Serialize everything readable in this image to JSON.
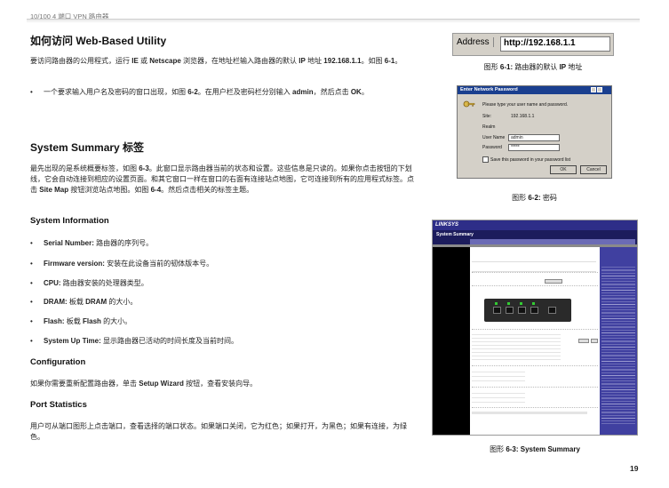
{
  "header": {
    "running_title": "10/100 4 端口 VPN 路由器",
    "page_number": "19"
  },
  "section1": {
    "title": "如何访问 Web-Based Utility",
    "intro_parts": [
      "要访问路由器的公用程式，运行 ",
      "IE",
      " 或 ",
      "Netscape",
      " 浏览器，在地址栏输入路由器的默认 ",
      "IP",
      " 地址 ",
      "192.168.1.1",
      "。如图 ",
      "6-1",
      "。"
    ],
    "bullet_parts": [
      "一个要求输入用户名及密码的窗口出现，如图 ",
      "6-2",
      "。在用户栏及密码栏分别输入 ",
      "admin",
      "，然后点击 ",
      "OK",
      "。"
    ]
  },
  "section2": {
    "title": "System Summary 标签",
    "intro_parts": [
      "最先出现的是系统概要标签，如图 ",
      "6-3",
      "。此窗口显示路由器当前的状态和设置。这些信息是只读的。如果你点击按钮的下划线，它会自动连接到相应的设置页面。和其它窗口一样在窗口的右面有连接站点地图，它可连接到所有的应用程式标签。点击 ",
      "Site Map",
      " 按钮浏览站点地图。如图 ",
      "6-4",
      "。然后点击相关的标签主题。"
    ]
  },
  "system_information": {
    "title": "System Information",
    "items": [
      {
        "term": "Serial Number:",
        "desc": " 路由器的序列号。"
      },
      {
        "term": "Firmware version:",
        "desc": " 安装在此设备当前的韧体版本号。"
      },
      {
        "term": "CPU:",
        "desc": " 路由器安装的处理器类型。"
      },
      {
        "term": "DRAM:",
        "desc_parts": [
          " 板载 ",
          "DRAM",
          " 的大小。"
        ]
      },
      {
        "term": "Flash:",
        "desc_parts": [
          " 板载 ",
          "Flash",
          " 的大小。"
        ]
      },
      {
        "term": "System Up Time:",
        "desc": " 显示路由器已活动的时间长度及当前时间。"
      }
    ]
  },
  "configuration": {
    "title": "Configuration",
    "text_parts": [
      "如果你需要重新配置路由器，单击 ",
      "Setup Wizard",
      " 按钮，查看安装向导。"
    ]
  },
  "port_statistics": {
    "title": "Port Statistics",
    "text": "用户可从端口图形上点击端口，查看选择的端口状态。如果端口关闭，它为红色；如果打开，为黑色；如果有连接，为绿色。"
  },
  "figures": {
    "fig1": {
      "address_label": "Address",
      "url": "http://192.168.1.1",
      "caption_pre": "图形 ",
      "caption_num": "6-1:",
      "caption_text": " 路由器的默认 ",
      "caption_bold2": "IP",
      "caption_end": " 地址"
    },
    "fig2": {
      "dialog_title": "Enter Network Password",
      "prompt": "Please type your user name and password.",
      "site_label": "Site:",
      "site_value": "192.168.1.1",
      "realm_label": "Realm",
      "user_label": "User Name",
      "user_value": "admin",
      "pass_label": "Password",
      "pass_value": "*****",
      "save_label": "Save this password in your password list",
      "ok_label": "OK",
      "cancel_label": "Cancel",
      "caption_pre": "图形 ",
      "caption_num": "6-2:",
      "caption_text": " 密码"
    },
    "fig3": {
      "brand": "LINKSYS",
      "section": "System Summary",
      "caption_pre": "图形 ",
      "caption_num": "6-3: System Summary"
    }
  },
  "colors": {
    "link_blue": "#1a3f8f",
    "linksys_nav": "#1c1c5c",
    "port_green": "#33cc33"
  }
}
